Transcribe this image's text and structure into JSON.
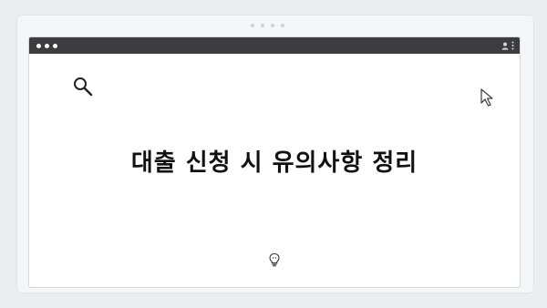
{
  "page": {
    "heading": "대출 신청 시 유의사항 정리"
  },
  "window": {
    "titlebar_color": "#3d3d3f",
    "icons": {
      "left": [
        "dot-icon",
        "dot-icon",
        "dot-icon"
      ],
      "right": [
        "user-icon",
        "more-vert-icon"
      ]
    }
  },
  "decorations": {
    "top_left": "search-icon",
    "top_right": "cursor-icon",
    "bottom_center": "lightbulb-icon"
  }
}
